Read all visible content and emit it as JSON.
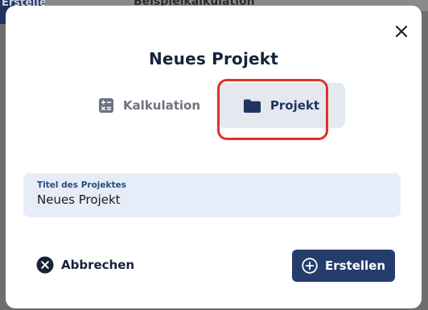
{
  "background": {
    "button_label": "Erstellen",
    "heading": "Beispielkalkulation"
  },
  "dialog": {
    "title": "Neues Projekt",
    "tabs": [
      {
        "label": "Kalkulation",
        "icon": "calculator-icon",
        "active": false
      },
      {
        "label": "Projekt",
        "icon": "folder-icon",
        "active": true
      }
    ],
    "field": {
      "label": "Titel des Projektes",
      "value": "Neues Projekt"
    },
    "cancel_label": "Abbrechen",
    "submit_label": "Erstellen"
  },
  "colors": {
    "primary": "#253d6c",
    "highlight": "#e0302a",
    "tab_active_bg": "#e4e9f0",
    "field_bg": "#e6edf8"
  }
}
